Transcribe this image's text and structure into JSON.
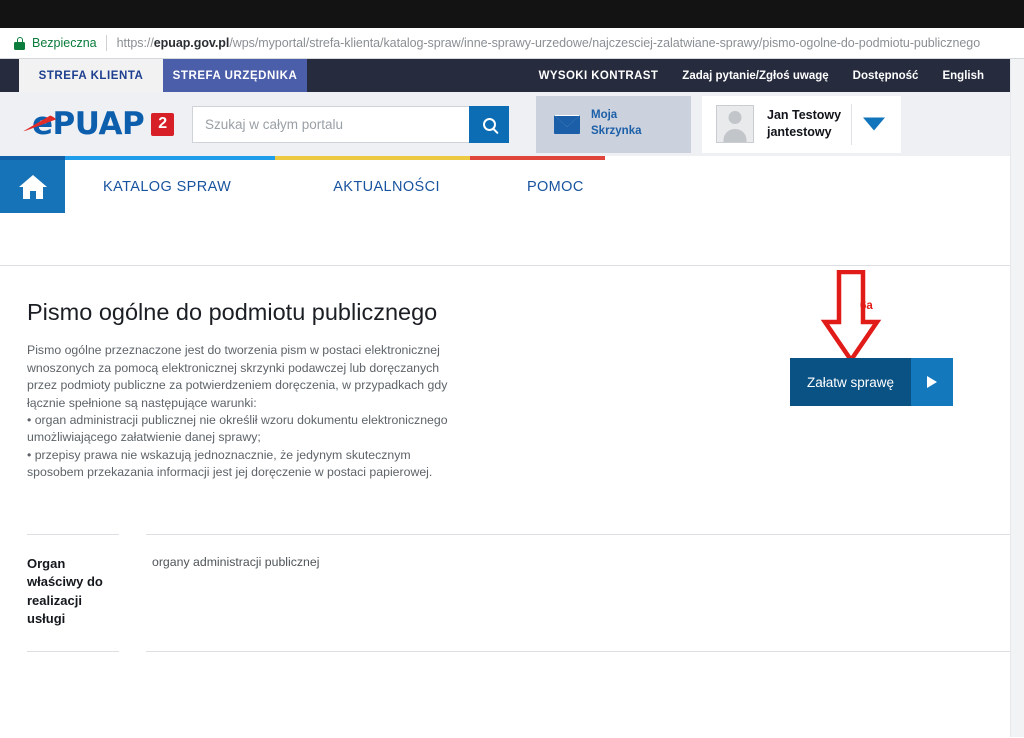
{
  "browser": {
    "security_label": "Bezpieczna",
    "lock_icon": "lock-icon",
    "url_scheme": "https://",
    "url_domain": "epuap.gov.pl",
    "url_path": "/wps/myportal/strefa-klienta/katalog-spraw/inne-sprawy-urzedowe/najczesciej-zalatwiane-sprawy/pismo-ogolne-do-podmiotu-publicznego"
  },
  "topbar": {
    "tabs": [
      {
        "label": "STREFA KLIENTA",
        "active": true
      },
      {
        "label": "STREFA URZĘDNIKA",
        "active": false
      }
    ],
    "links": [
      "WYSOKI KONTRAST",
      "Zadaj pytanie/Zgłoś uwagę",
      "Dostępność",
      "English"
    ]
  },
  "header": {
    "logo_text": "ePUAP",
    "logo_badge": "2",
    "search_placeholder": "Szukaj w całym portalu",
    "search_value": "",
    "search_icon": "search-icon",
    "mailbox_line1": "Moja",
    "mailbox_line2": "Skrzynka",
    "mailbox_icon": "envelope-icon",
    "account_name": "Jan Testowy",
    "account_login": "jantestowy",
    "avatar_icon": "user-avatar-icon",
    "caret_icon": "chevron-down-icon"
  },
  "nav": {
    "home_icon": "home-icon",
    "items": [
      "KATALOG SPRAW",
      "AKTUALNOŚCI",
      "POMOC"
    ],
    "colors": {
      "blue": "#1f9cea",
      "yellow": "#edc841",
      "red": "#e0453c",
      "home_bg": "#1773b8"
    }
  },
  "main": {
    "title": "Pismo ogólne do podmiotu publicznego",
    "description": "Pismo ogólne przeznaczone jest do tworzenia pism w postaci elektronicznej wnoszonych za pomocą elektronicznej skrzynki podawczej lub doręczanych przez podmioty publiczne za potwierdzeniem doręczenia, w przypadkach gdy łącznie spełnione są następujące warunki:\n• organ administracji publicznej nie określił wzoru dokumentu elektronicznego umożliwiającego załatwienie danej sprawy;\n• przepisy prawa nie wskazują jednoznacznie, że jedynym skutecznym sposobem przekazania informacji jest jej doręczenie w postaci papierowej.",
    "cta_label": "Załatw sprawę",
    "cta_arrow_icon": "play-triangle-icon",
    "cta_color": "#0b5284",
    "cta_arrow_color": "#1478bd"
  },
  "annotation": {
    "label": "6a",
    "color": "#e11b18",
    "icon": "down-arrow-annotation-icon"
  },
  "info_table": {
    "rows": [
      {
        "label": "Organ właściwy do realizacji usługi",
        "value": "organy administracji publicznej"
      }
    ]
  }
}
